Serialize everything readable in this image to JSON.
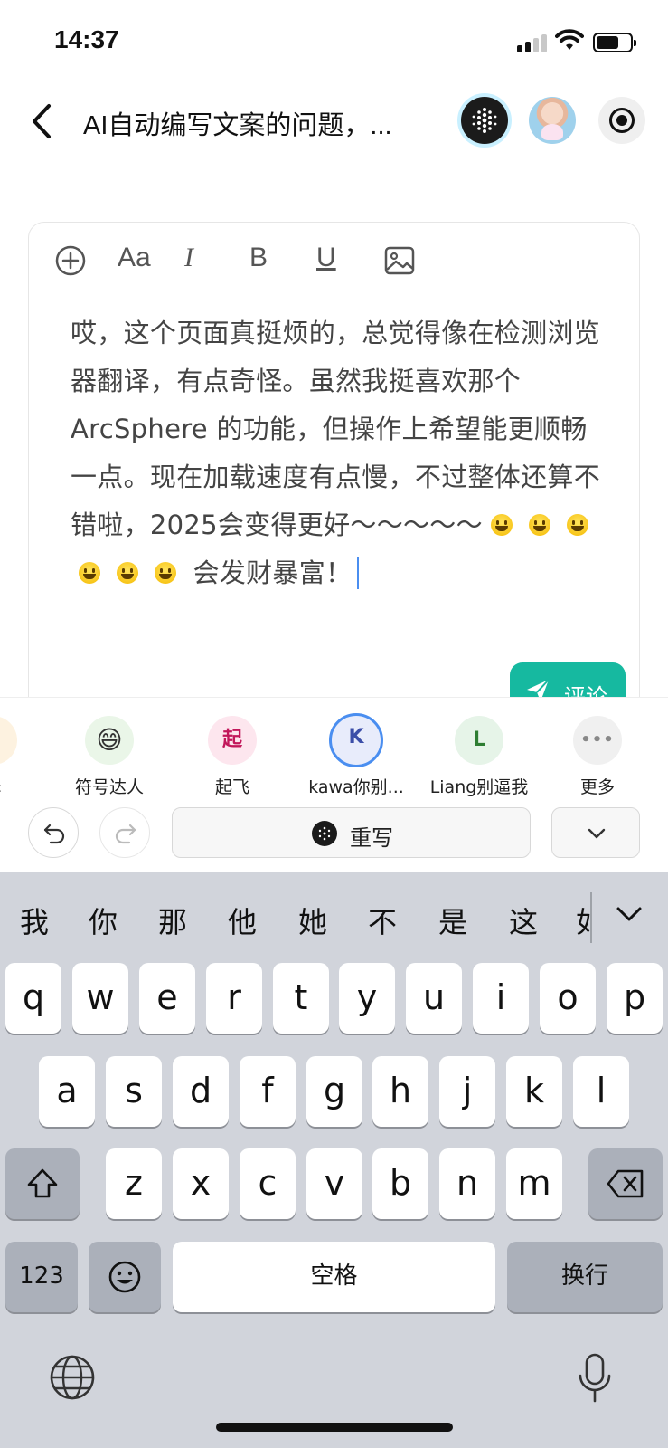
{
  "status_bar": {
    "time": "14:37"
  },
  "nav": {
    "title": "AI自动编写文案的问题，...",
    "back_icon": "chevron-left-icon",
    "icons": [
      "arcsphere-logo-icon",
      "user-avatar",
      "record-icon"
    ]
  },
  "editor": {
    "toolbar": {
      "add_icon": "plus-circle-icon",
      "font_label": "Aa",
      "italic_label": "I",
      "bold_label": "B",
      "underline_label": "U",
      "image_icon": "image-icon"
    },
    "text_part1": "哎，这个页面真挺烦的，总觉得像在检测浏览器翻译，有点奇怪。虽然我挺喜欢那个ArcSphere 的功能，但操作上希望能更顺畅一点。现在加载速度有点慢，不过整体还算不错啦，2025会变得更好～～～～～",
    "emoji_count": 6,
    "text_part2": "会发财暴富！",
    "comment_button": "评论",
    "accent_color": "#16b9a0"
  },
  "ai_panel": {
    "agents": [
      {
        "name": "译",
        "avatar_text": "",
        "bg": "#fdf2e0",
        "fg": "#d08a20"
      },
      {
        "name": "符号达人",
        "avatar_text": "😄",
        "bg": "#eaf6e8",
        "fg": "#333"
      },
      {
        "name": "起飞",
        "avatar_text": "起",
        "bg": "#fde6ee",
        "fg": "#c2185b"
      },
      {
        "name": "kawa你别...",
        "avatar_text": "K",
        "bg": "#e8ecfb",
        "fg": "#3b4ea8"
      },
      {
        "name": "Liang别逼我",
        "avatar_text": "L",
        "bg": "#e6f4e8",
        "fg": "#2e7d32"
      },
      {
        "name": "更多",
        "avatar_text": "•••",
        "bg": "#f0f0f0",
        "fg": "#888"
      }
    ],
    "undo_icon": "undo-icon",
    "redo_icon": "redo-icon",
    "rewrite_label": "重写",
    "dropdown_icon": "chevron-down-icon"
  },
  "keyboard": {
    "candidates": [
      "我",
      "你",
      "那",
      "他",
      "她",
      "不",
      "是",
      "这",
      "如"
    ],
    "row1": [
      "q",
      "w",
      "e",
      "r",
      "t",
      "y",
      "u",
      "i",
      "o",
      "p"
    ],
    "row2": [
      "a",
      "s",
      "d",
      "f",
      "g",
      "h",
      "j",
      "k",
      "l"
    ],
    "row3": [
      "z",
      "x",
      "c",
      "v",
      "b",
      "n",
      "m"
    ],
    "numbers_label": "123",
    "space_label": "空格",
    "return_label": "换行",
    "shift_icon": "shift-icon",
    "delete_icon": "backspace-icon",
    "emoji_icon": "emoji-icon",
    "globe_icon": "globe-icon",
    "mic_icon": "microphone-icon"
  }
}
